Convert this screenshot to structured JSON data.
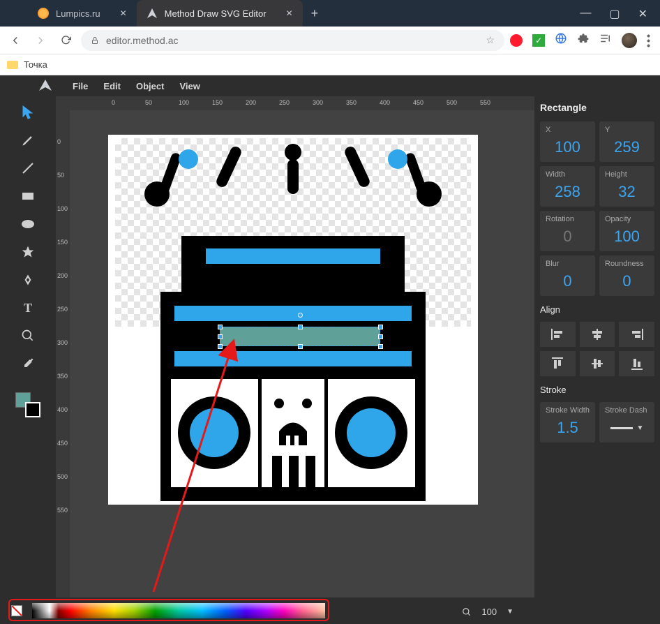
{
  "window": {
    "tabs": [
      {
        "title": "Lumpics.ru",
        "active": false
      },
      {
        "title": "Method Draw SVG Editor",
        "active": true
      }
    ]
  },
  "browser": {
    "url": "editor.method.ac",
    "bookmarks": [
      {
        "label": "Точка"
      }
    ]
  },
  "app": {
    "menu": [
      "File",
      "Edit",
      "Object",
      "View"
    ],
    "ruler_ticks_h": [
      "0",
      "50",
      "100",
      "150",
      "200",
      "250",
      "300",
      "350",
      "400",
      "450",
      "500",
      "550"
    ],
    "ruler_ticks_v": [
      "0",
      "50",
      "100",
      "150",
      "200",
      "250",
      "300",
      "350",
      "400",
      "450",
      "500",
      "550"
    ],
    "zoom": {
      "value": "100"
    },
    "selected_fill": "#5fa099",
    "props": {
      "title": "Rectangle",
      "x": {
        "label": "X",
        "value": "100"
      },
      "y": {
        "label": "Y",
        "value": "259"
      },
      "width": {
        "label": "Width",
        "value": "258"
      },
      "height": {
        "label": "Height",
        "value": "32"
      },
      "rotation": {
        "label": "Rotation",
        "value": "0"
      },
      "opacity": {
        "label": "Opacity",
        "value": "100"
      },
      "blur": {
        "label": "Blur",
        "value": "0"
      },
      "roundness": {
        "label": "Roundness",
        "value": "0"
      },
      "align_label": "Align",
      "stroke_label": "Stroke",
      "stroke_width": {
        "label": "Stroke Width",
        "value": "1.5"
      },
      "stroke_dash": {
        "label": "Stroke Dash"
      }
    }
  }
}
